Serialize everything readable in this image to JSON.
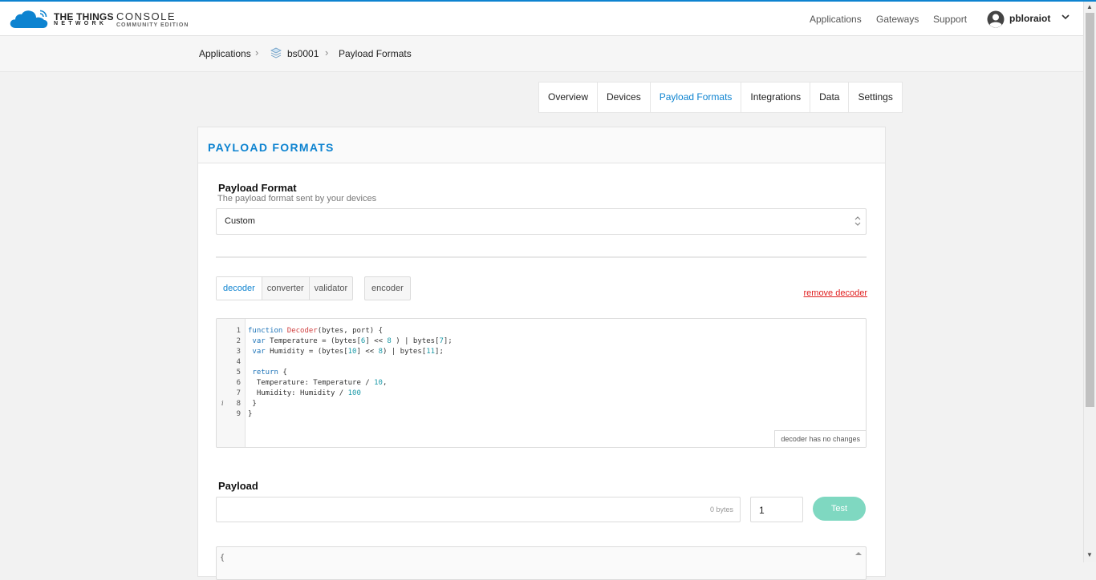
{
  "header": {
    "brand_top": "THE THINGS",
    "brand_bottom": "NETWORK",
    "console_title": "CONSOLE",
    "console_subtitle": "COMMUNITY EDITION",
    "nav": [
      "Applications",
      "Gateways",
      "Support"
    ],
    "username": "pbloraiot"
  },
  "breadcrumb": {
    "root": "Applications",
    "app": "bs0001",
    "current": "Payload Formats"
  },
  "tabs": [
    {
      "label": "Overview",
      "active": false
    },
    {
      "label": "Devices",
      "active": false
    },
    {
      "label": "Payload Formats",
      "active": true
    },
    {
      "label": "Integrations",
      "active": false
    },
    {
      "label": "Data",
      "active": false
    },
    {
      "label": "Settings",
      "active": false
    }
  ],
  "card": {
    "title": "PAYLOAD FORMATS",
    "format_label": "Payload Format",
    "format_desc": "The payload format sent by your devices",
    "format_value": "Custom",
    "function_tabs": [
      "decoder",
      "converter",
      "validator"
    ],
    "encoder_label": "encoder",
    "remove_label": "remove decoder",
    "editor_status": "decoder has no changes",
    "payload_label": "Payload",
    "payload_value": "",
    "payload_hint": "0 bytes",
    "port_value": "1",
    "test_label": "Test",
    "output_first_line": "{"
  },
  "code_lines": [
    "function Decoder(bytes, port) {",
    " var Temperature = (bytes[6] << 8 ) | bytes[7];",
    " var Humidity = (bytes[10] << 8) | bytes[11];",
    "",
    " return {",
    "  Temperature: Temperature / 10,",
    "  Humidity: Humidity / 100",
    " }",
    "}"
  ],
  "colors": {
    "accent": "#0d83d0",
    "danger": "#e02020",
    "test_button": "#7fd8c1"
  }
}
